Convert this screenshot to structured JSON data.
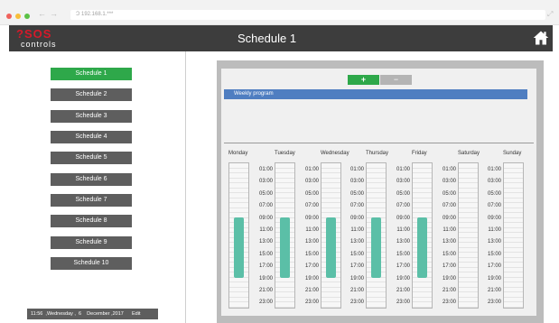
{
  "browser": {
    "url": "Ɔ  192.168.1.***",
    "dot_colors": [
      "#f0625c",
      "#f7be3b",
      "#5bc146"
    ],
    "back_arrow": "←",
    "forward_arrow": "→",
    "expand_icon": "⤢"
  },
  "header": {
    "logo_line1": "?SOS",
    "logo_line2": "controls",
    "title": "Schedule 1",
    "home_icon": "home-icon"
  },
  "sidebar": {
    "items": [
      {
        "label": "Schedule 1",
        "active": true
      },
      {
        "label": "Schedule 2",
        "active": false
      },
      {
        "label": "Schedule 3",
        "active": false
      },
      {
        "label": "Schedule 4",
        "active": false
      },
      {
        "label": "Schedule 5",
        "active": false
      },
      {
        "label": "Schedule 6",
        "active": false
      },
      {
        "label": "Schedule 7",
        "active": false
      },
      {
        "label": "Schedule 8",
        "active": false
      },
      {
        "label": "Schedule 9",
        "active": false
      },
      {
        "label": "Schedule 10",
        "active": false
      }
    ],
    "footer": "11:56  ,Wednesday ,  6    December ,2017      Edit"
  },
  "main": {
    "add_label": "+",
    "remove_label": "−",
    "program_label": "Weekly program",
    "days": [
      "Monday",
      "Tuesday",
      "Wednesday",
      "Thursday",
      "Friday",
      "Saturday",
      "Sunday"
    ],
    "times": [
      "01:00",
      "03:00",
      "05:00",
      "07:00",
      "09:00",
      "11:00",
      "13:00",
      "15:00",
      "17:00",
      "19:00",
      "21:00",
      "23:00"
    ],
    "active_color": "#5bbfa7",
    "accent_green": "#2ea84a",
    "program_blue": "#4f7ec1"
  }
}
